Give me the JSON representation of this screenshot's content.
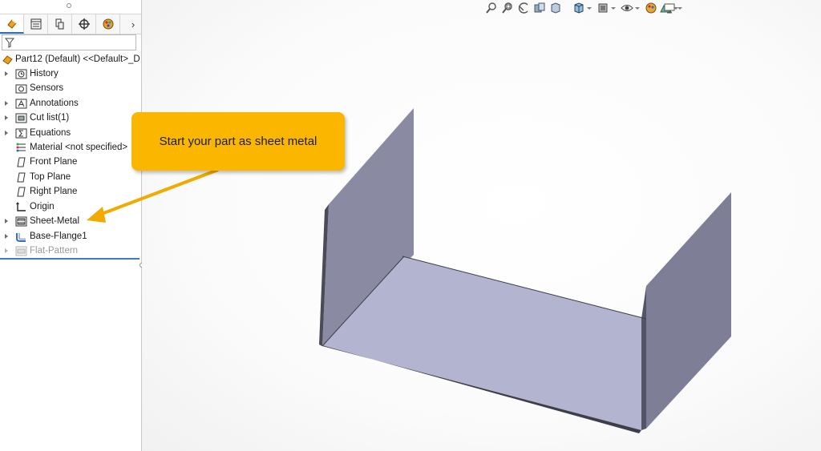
{
  "panel": {
    "tabs": [
      {
        "name": "featuremanager-icon",
        "active": true
      },
      {
        "name": "propertymanager-icon",
        "active": false
      },
      {
        "name": "configurationmanager-icon",
        "active": false
      },
      {
        "name": "dimxpert-icon",
        "active": false
      },
      {
        "name": "display-manager-icon",
        "active": false
      }
    ],
    "more_label": "›",
    "filter_icon": "filter-icon",
    "tree": {
      "root": "Part12 (Default) <<Default>_D",
      "items": [
        {
          "label": "History",
          "icon": "history-folder-icon",
          "expandable": true
        },
        {
          "label": "Sensors",
          "icon": "sensors-icon",
          "expandable": false
        },
        {
          "label": "Annotations",
          "icon": "annotations-icon",
          "expandable": true
        },
        {
          "label": "Cut list(1)",
          "icon": "cut-list-icon",
          "expandable": true
        },
        {
          "label": "Equations",
          "icon": "equations-icon",
          "expandable": true
        },
        {
          "label": "Material <not specified>",
          "icon": "material-icon",
          "expandable": false
        },
        {
          "label": "Front Plane",
          "icon": "plane-icon",
          "expandable": false
        },
        {
          "label": "Top Plane",
          "icon": "plane-icon",
          "expandable": false
        },
        {
          "label": "Right Plane",
          "icon": "plane-icon",
          "expandable": false
        },
        {
          "label": "Origin",
          "icon": "origin-icon",
          "expandable": false
        },
        {
          "label": "Sheet-Metal",
          "icon": "sheet-metal-icon",
          "expandable": true
        },
        {
          "label": "Base-Flange1",
          "icon": "base-flange-icon",
          "expandable": true
        },
        {
          "label": "Flat-Pattern",
          "icon": "flat-pattern-icon",
          "expandable": true,
          "suppressed": true
        }
      ]
    }
  },
  "headsup_toolbar": [
    "zoom-to-fit-icon",
    "zoom-to-area-icon",
    "previous-view-icon",
    "section-view-icon",
    "dynamic-annotation-icon",
    "view-orientation-icon",
    "display-style-icon",
    "hide-show-items-icon",
    "edit-appearance-icon",
    "apply-scene-icon",
    "view-settings-icon"
  ],
  "callout": {
    "text": "Start your part as sheet metal"
  },
  "colors": {
    "accent": "#fbb700",
    "rollback_bar": "#3b7dc4",
    "model_face": "#b3b4cf",
    "model_wall": "#7f7f97"
  }
}
